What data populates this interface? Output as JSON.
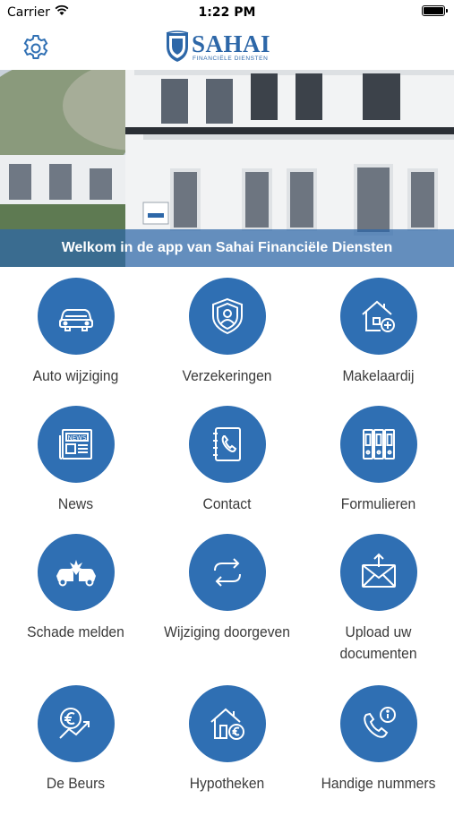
{
  "status_bar": {
    "carrier": "Carrier",
    "time": "1:22 PM"
  },
  "header": {
    "logo_name": "SAHAI",
    "logo_subtitle": "FINANCIËLE DIENSTEN",
    "settings_icon": "gear-icon",
    "brand_color": "#2f6fb3"
  },
  "hero": {
    "welcome": "Welkom in de app van Sahai Financiële Diensten"
  },
  "menu": [
    {
      "label": "Auto wijziging",
      "icon": "car-icon"
    },
    {
      "label": "Verzekeringen",
      "icon": "shield-user-icon"
    },
    {
      "label": "Makelaardij",
      "icon": "house-plus-icon"
    },
    {
      "label": "News",
      "icon": "newspaper-icon"
    },
    {
      "label": "Contact",
      "icon": "phone-book-icon"
    },
    {
      "label": "Formulieren",
      "icon": "binders-icon"
    },
    {
      "label": "Schade melden",
      "icon": "car-crash-icon"
    },
    {
      "label": "Wijziging doorgeven",
      "icon": "sync-arrows-icon"
    },
    {
      "label": "Upload uw documenten",
      "icon": "upload-envelope-icon"
    },
    {
      "label": "De Beurs",
      "icon": "euro-trend-icon"
    },
    {
      "label": "Hypotheken",
      "icon": "house-euro-icon"
    },
    {
      "label": "Handige nummers",
      "icon": "phone-info-icon"
    }
  ]
}
